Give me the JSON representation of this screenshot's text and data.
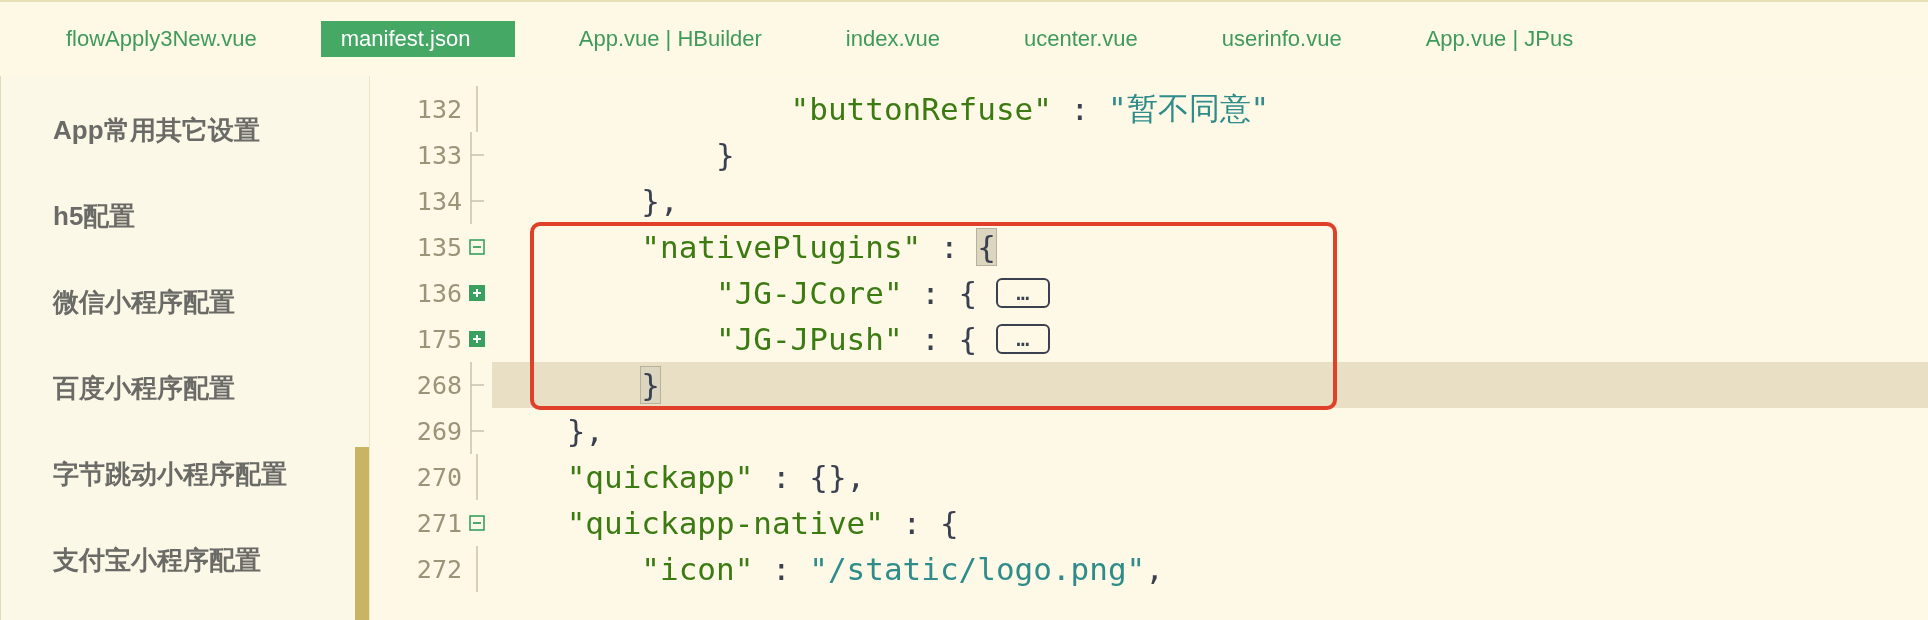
{
  "tabs": [
    {
      "label": "flowApply3New.vue",
      "selected": false
    },
    {
      "label": "manifest.json",
      "selected": true
    },
    {
      "label": "App.vue | HBuilder",
      "selected": false
    },
    {
      "label": "index.vue",
      "selected": false
    },
    {
      "label": "ucenter.vue",
      "selected": false
    },
    {
      "label": "userinfo.vue",
      "selected": false
    },
    {
      "label": "App.vue | JPus",
      "selected": false
    }
  ],
  "sidebar": {
    "items": [
      "App常用其它设置",
      "h5配置",
      "微信小程序配置",
      "百度小程序配置",
      "字节跳动小程序配置",
      "支付宝小程序配置"
    ]
  },
  "editor": {
    "lines": [
      {
        "number": "132",
        "kind": "plain",
        "current": false,
        "annotated": false,
        "tokens": [
          {
            "kind": "key",
            "text": "                \"buttonRefuse\""
          },
          {
            "kind": "punct",
            "text": " : "
          },
          {
            "kind": "string",
            "text": "\"暂不同意\""
          }
        ]
      },
      {
        "number": "133",
        "kind": "end",
        "current": false,
        "annotated": false,
        "tokens": [
          {
            "kind": "punct",
            "text": "            }"
          }
        ]
      },
      {
        "number": "134",
        "kind": "end",
        "current": false,
        "annotated": false,
        "tokens": [
          {
            "kind": "punct",
            "text": "        },"
          }
        ]
      },
      {
        "number": "135",
        "kind": "collapse",
        "current": false,
        "annotated": true,
        "tokens": [
          {
            "kind": "key",
            "text": "        \"nativePlugins\""
          },
          {
            "kind": "punct",
            "text": " : "
          },
          {
            "kind": "match",
            "text": "{"
          }
        ]
      },
      {
        "number": "136",
        "kind": "expand",
        "current": false,
        "annotated": true,
        "tokens": [
          {
            "kind": "key",
            "text": "            \"JG-JCore\""
          },
          {
            "kind": "punct",
            "text": " : { "
          },
          {
            "kind": "folded",
            "text": "…"
          }
        ]
      },
      {
        "number": "175",
        "kind": "expand",
        "current": false,
        "annotated": true,
        "tokens": [
          {
            "kind": "key",
            "text": "            \"JG-JPush\""
          },
          {
            "kind": "punct",
            "text": " : { "
          },
          {
            "kind": "folded",
            "text": "…"
          }
        ]
      },
      {
        "number": "268",
        "kind": "end",
        "current": true,
        "annotated": true,
        "tokens": [
          {
            "kind": "match",
            "text": "        }"
          }
        ]
      },
      {
        "number": "269",
        "kind": "end",
        "current": false,
        "annotated": false,
        "tokens": [
          {
            "kind": "punct",
            "text": "    },"
          }
        ]
      },
      {
        "number": "270",
        "kind": "plain",
        "current": false,
        "annotated": false,
        "tokens": [
          {
            "kind": "key",
            "text": "    \"quickapp\""
          },
          {
            "kind": "punct",
            "text": " : {},"
          }
        ]
      },
      {
        "number": "271",
        "kind": "collapse",
        "current": false,
        "annotated": false,
        "tokens": [
          {
            "kind": "key",
            "text": "    \"quickapp-native\""
          },
          {
            "kind": "punct",
            "text": " : {"
          }
        ]
      },
      {
        "number": "272",
        "kind": "plain",
        "current": false,
        "annotated": false,
        "tokens": [
          {
            "kind": "key",
            "text": "        \"icon\""
          },
          {
            "kind": "punct",
            "text": " : "
          },
          {
            "kind": "string",
            "text": "\"/static/logo.png\""
          },
          {
            "kind": "punct",
            "text": ","
          }
        ]
      }
    ]
  }
}
